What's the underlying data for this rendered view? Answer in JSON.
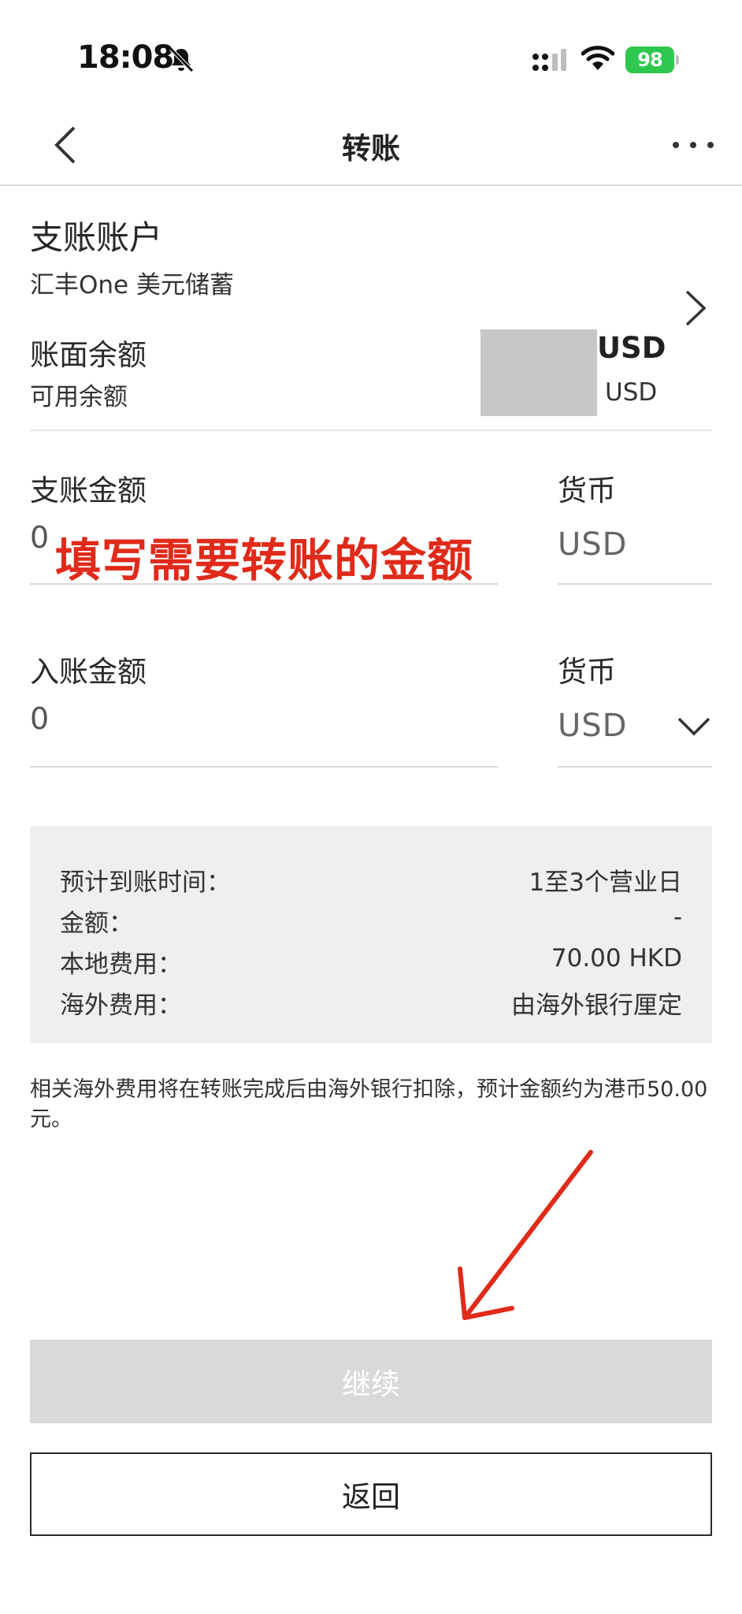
{
  "status_bar": {
    "time": "18:08",
    "battery": "98"
  },
  "header": {
    "title": "转账"
  },
  "debit_account": {
    "title": "支账账户",
    "name": "汇丰One 美元储蓄",
    "book_balance_label": "账面余额",
    "available_balance_label": "可用余额",
    "book_balance_currency": "USD",
    "available_balance_currency": "USD"
  },
  "debit_amount": {
    "label": "支账金额",
    "value": "0",
    "currency_label": "货币",
    "currency": "USD"
  },
  "annotation_text": "填写需要转账的金额",
  "credit_amount": {
    "label": "入账金额",
    "value": "0",
    "currency_label": "货币",
    "currency": "USD"
  },
  "summary": {
    "rows": [
      {
        "label": "预计到账时间：",
        "value": "1至3个营业日"
      },
      {
        "label": "金额：",
        "value": "-"
      },
      {
        "label": "本地费用：",
        "value": "70.00 HKD"
      },
      {
        "label": "海外费用：",
        "value": "由海外银行厘定"
      }
    ]
  },
  "note": "相关海外费用将在转账完成后由海外银行扣除，预计金额约为港币50.00元。",
  "buttons": {
    "continue": "继续",
    "back": "返回"
  },
  "colors": {
    "annotation": "#e02a1a",
    "battery": "#2fc84f",
    "disabled_button": "#d9d9d9"
  }
}
